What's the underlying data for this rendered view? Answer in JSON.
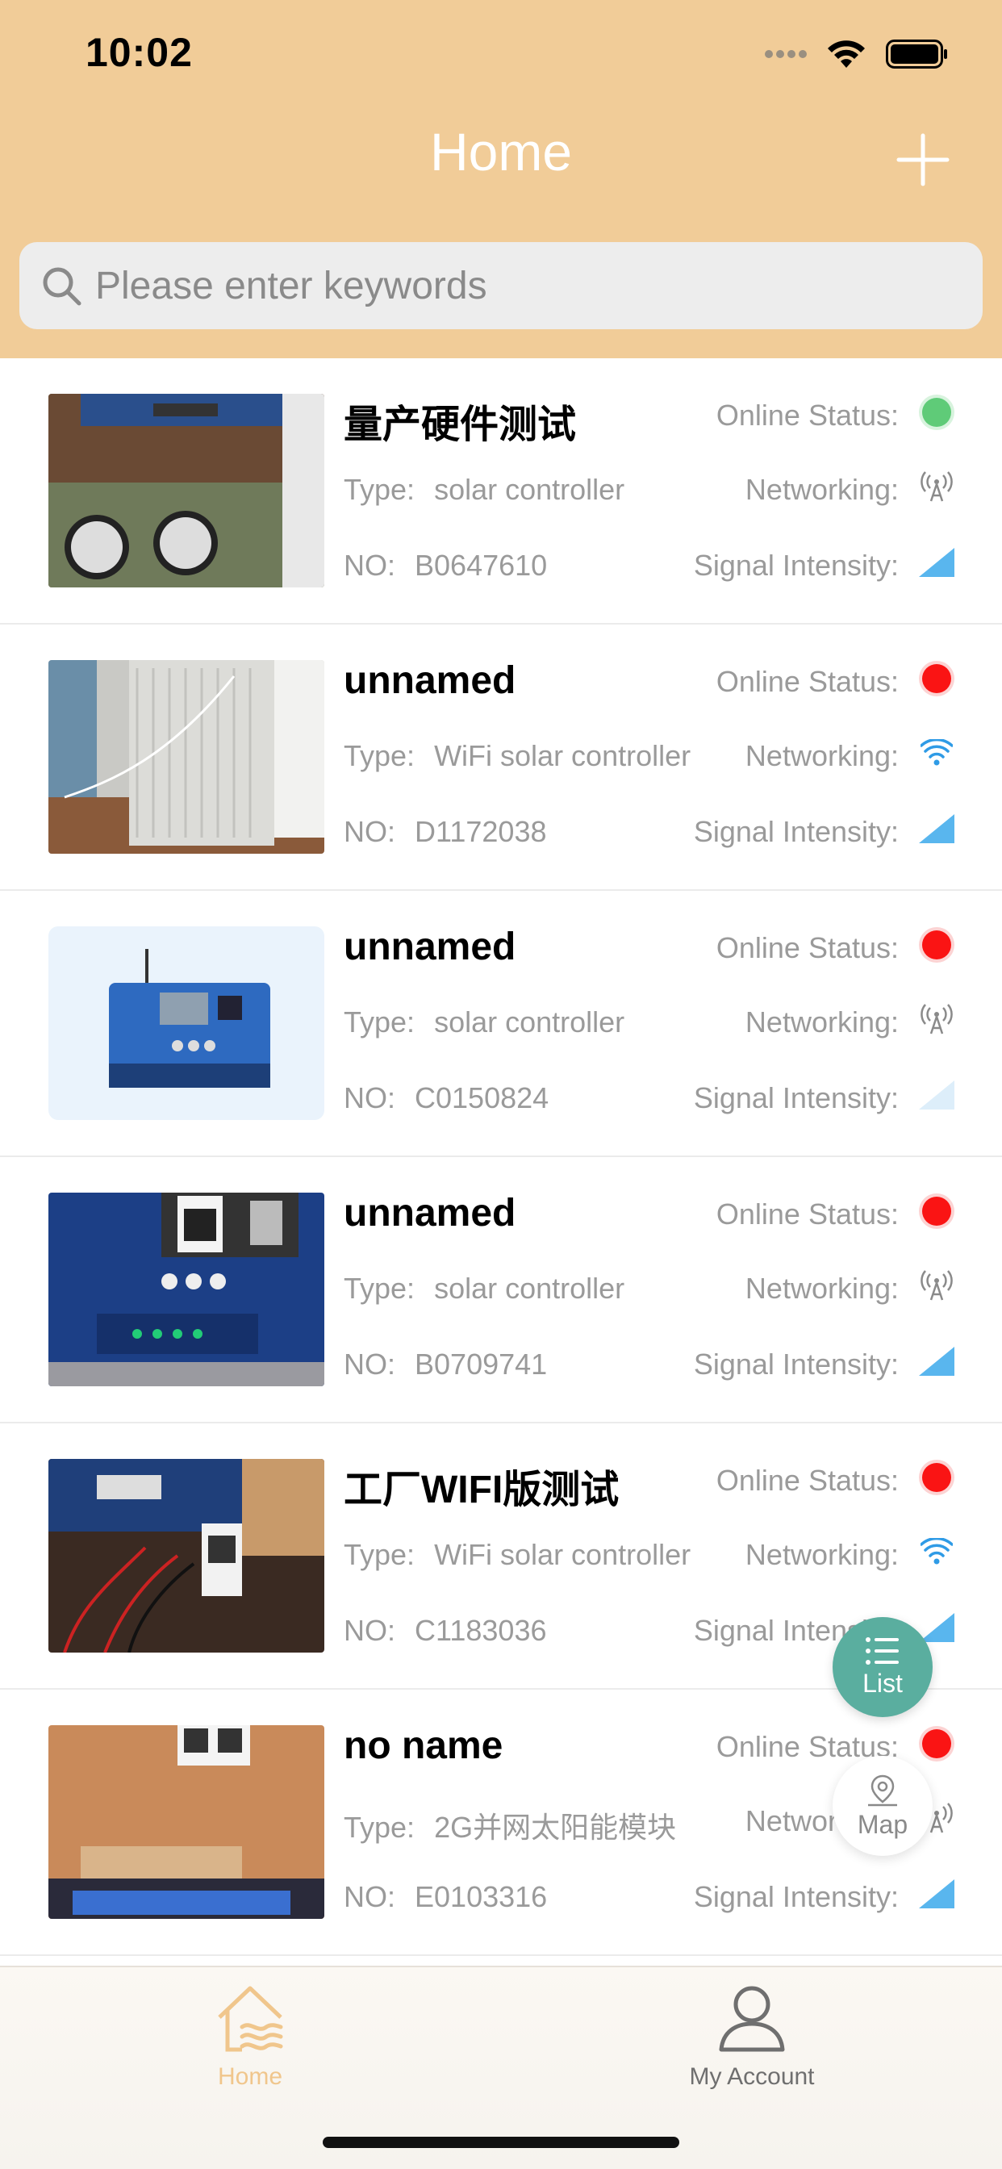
{
  "status_bar": {
    "time": "10:02"
  },
  "header": {
    "title": "Home"
  },
  "search": {
    "placeholder": "Please enter keywords"
  },
  "labels": {
    "type": "Type:",
    "no": "NO:",
    "online_status": "Online Status:",
    "networking": "Networking:",
    "signal_intensity": "Signal Intensity:"
  },
  "devices": [
    {
      "name": "量产硬件测试",
      "type": "solar controller",
      "no": "B0647610",
      "online": "online",
      "network": "cellular",
      "signal": "strong"
    },
    {
      "name": "unnamed",
      "type": "WiFi solar controller",
      "no": "D1172038",
      "online": "offline",
      "network": "wifi",
      "signal": "strong"
    },
    {
      "name": "unnamed",
      "type": "solar controller",
      "no": "C0150824",
      "online": "offline",
      "network": "cellular",
      "signal": "weak"
    },
    {
      "name": "unnamed",
      "type": "solar controller",
      "no": "B0709741",
      "online": "offline",
      "network": "cellular",
      "signal": "strong"
    },
    {
      "name": "工厂WIFI版测试",
      "type": "WiFi solar controller",
      "no": "C1183036",
      "online": "offline",
      "network": "wifi",
      "signal": "strong"
    },
    {
      "name": "no name",
      "type": "2G并网太阳能模块",
      "no": "E0103316",
      "online": "offline",
      "network": "cellular",
      "signal": "strong"
    }
  ],
  "floating": {
    "list_label": "List",
    "map_label": "Map"
  },
  "tabbar": {
    "home_label": "Home",
    "account_label": "My Account"
  },
  "colors": {
    "header_bg": "#F1CC98",
    "online": "#5FCB78",
    "offline": "#FA1414",
    "signal": "#59B6EE",
    "list_fab": "#5AAE9F",
    "tab_active": "#F0C68C"
  }
}
